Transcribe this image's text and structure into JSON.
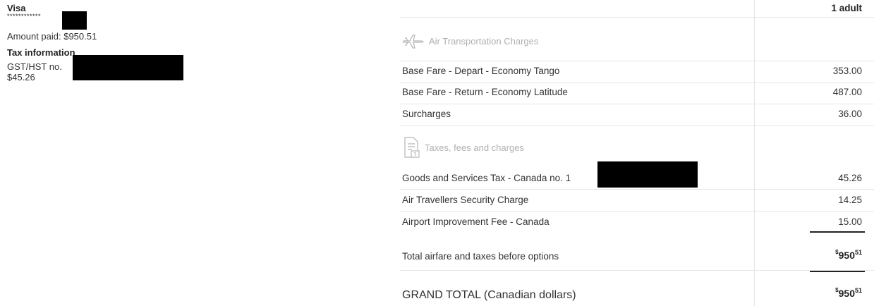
{
  "payment": {
    "card_type": "Visa",
    "card_mask": "************",
    "amount_paid": "Amount paid: $950.51"
  },
  "tax_info": {
    "heading": "Tax information",
    "gst_label": "GST/HST no.",
    "gst_amount": "$45.26"
  },
  "table": {
    "passenger_header": "1 adult",
    "sections": {
      "air": "Air Transportation Charges",
      "taxes": "Taxes, fees and charges"
    },
    "air_rows": [
      {
        "label": "Base Fare - Depart -  Economy Tango",
        "amount": "353.00"
      },
      {
        "label": "Base Fare - Return -  Economy Latitude",
        "amount": "487.00"
      },
      {
        "label": "Surcharges",
        "amount": "36.00"
      }
    ],
    "tax_rows": [
      {
        "label": "Goods and Services Tax - Canada no. 1",
        "amount": "45.26"
      },
      {
        "label": "Air Travellers Security Charge",
        "amount": "14.25"
      },
      {
        "label": "Airport Improvement Fee - Canada",
        "amount": "15.00"
      }
    ],
    "subtotal": {
      "label": "Total airfare and taxes before options",
      "currency": "$",
      "whole": "950",
      "cents": "51"
    },
    "grand_total": {
      "label": "GRAND TOTAL (Canadian dollars)",
      "currency": "$",
      "whole": "950",
      "cents": "51"
    }
  },
  "icons": {
    "air_section": "airplane-icon",
    "tax_section": "receipt-icon"
  }
}
